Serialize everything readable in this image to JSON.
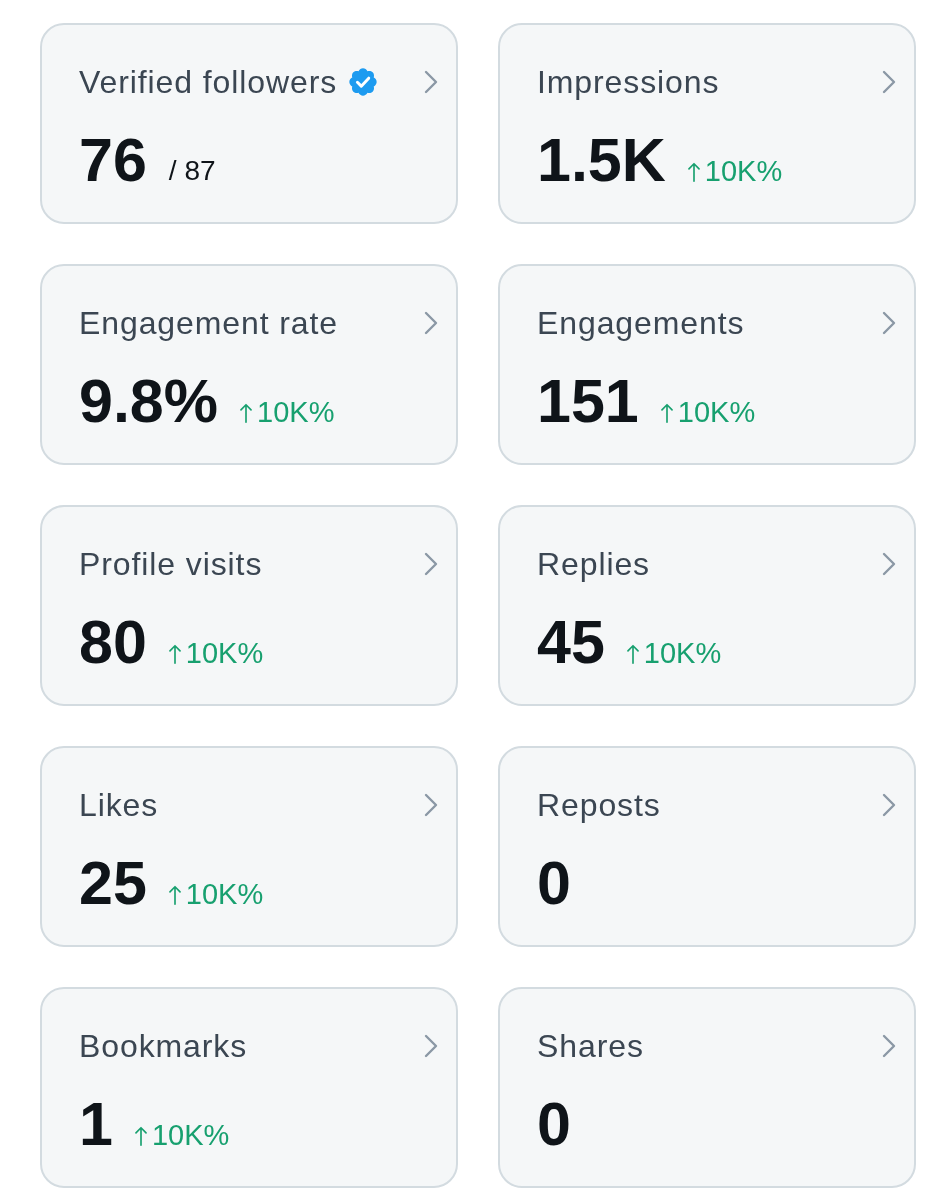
{
  "cards": [
    {
      "title": "Verified followers",
      "verified": true,
      "value": "76",
      "total": "/ 87"
    },
    {
      "title": "Impressions",
      "verified": false,
      "value": "1.5K",
      "trend": {
        "kind": "up",
        "text": "10K%"
      }
    },
    {
      "title": "Engagement rate",
      "verified": false,
      "value": "9.8%",
      "trend": {
        "kind": "up",
        "text": "10K%"
      }
    },
    {
      "title": "Engagements",
      "verified": false,
      "value": "151",
      "trend": {
        "kind": "up",
        "text": "10K%"
      }
    },
    {
      "title": "Profile visits",
      "verified": false,
      "value": "80",
      "trend": {
        "kind": "up",
        "text": "10K%"
      }
    },
    {
      "title": "Replies",
      "verified": false,
      "value": "45",
      "trend": {
        "kind": "up",
        "text": "10K%"
      }
    },
    {
      "title": "Likes",
      "verified": false,
      "value": "25",
      "trend": {
        "kind": "up",
        "text": "10K%"
      }
    },
    {
      "title": "Reposts",
      "verified": false,
      "value": "0"
    },
    {
      "title": "Bookmarks",
      "verified": false,
      "value": "1",
      "trend": {
        "kind": "up",
        "text": "10K%"
      }
    },
    {
      "title": "Shares",
      "verified": false,
      "value": "0"
    }
  ]
}
